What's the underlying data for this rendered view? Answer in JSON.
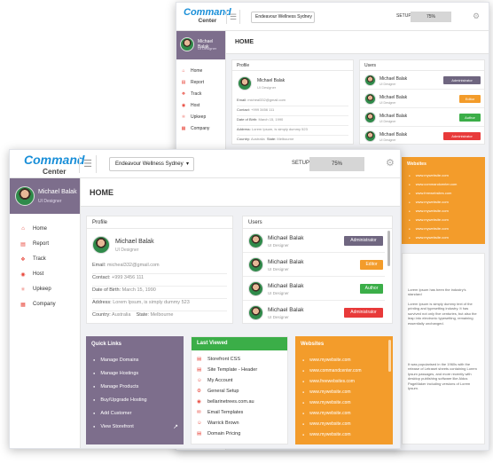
{
  "app": {
    "logo_main": "Command",
    "logo_sub": "Center",
    "company": "Endeavour Wellness Sydney",
    "setup_label": "SETUP",
    "setup_percent": "75%"
  },
  "user": {
    "name": "Michael Balak",
    "role": "UI Designer"
  },
  "sidebar": {
    "items": [
      {
        "label": "Home",
        "icon": "home-icon"
      },
      {
        "label": "Report",
        "icon": "report-icon"
      },
      {
        "label": "Track",
        "icon": "track-icon"
      },
      {
        "label": "Host",
        "icon": "host-icon"
      },
      {
        "label": "Upkeep",
        "icon": "upkeep-icon"
      },
      {
        "label": "Company",
        "icon": "company-icon"
      }
    ]
  },
  "page": {
    "title": "HOME"
  },
  "profile": {
    "header": "Profile",
    "name": "Michael Balak",
    "role": "UI Designer",
    "email_label": "Email:",
    "email": "micheal332@gmail.com",
    "contact_label": "Contact:",
    "contact": "+999 3456 111",
    "dob_label": "Date of Birth:",
    "dob": "March 15, 1990",
    "address_label": "Address:",
    "address": "Lorem Ipsum, is simply dummy 523",
    "country_label": "Country:",
    "country": "Australia",
    "state_label": "State:",
    "state": "Melbourne"
  },
  "users": {
    "header": "Users",
    "rows": [
      {
        "name": "Michael Balak",
        "role": "UI Designer",
        "badge": "Administrator",
        "color": "#6f6680"
      },
      {
        "name": "Michael Balak",
        "role": "UI Designer",
        "badge": "Editor",
        "color": "#f39c2b"
      },
      {
        "name": "Michael Balak",
        "role": "UI Designer",
        "badge": "Author",
        "color": "#3bae48"
      },
      {
        "name": "Michael Balak",
        "role": "UI Designer",
        "badge": "Administrator",
        "color": "#e83a3a"
      }
    ]
  },
  "quick_links": {
    "header": "Quick Links",
    "items": [
      "Manage Domains",
      "Manage Hostings",
      "Manage Products",
      "Buy/Upgrade Hosting",
      "Add Customer",
      "View Storefront"
    ]
  },
  "last_viewed": {
    "header": "Last Viewed",
    "items": [
      "Storefront CSS",
      "Site Template - Header",
      "My Account",
      "General Setup",
      "bellarinetrees.com.au",
      "Email Templates",
      "Warrick Brown",
      "Domain Pricing"
    ]
  },
  "websites": {
    "header": "Websites",
    "items": [
      "www.mywebsite.com",
      "www.commandcenter.com",
      "www.freewebsites.com",
      "www.mywebsite.com",
      "www.mywebsite.com",
      "www.mywebsite.com",
      "www.mywebsite.com",
      "www.mywebsite.com"
    ]
  },
  "back_text": {
    "p1": "Lorem Ipsum has been the industry's standard",
    "p2": "Lorem Ipsum is simply dummy text of the printing and typesetting industry. It has survived not only five centuries, but also the leap into electronic typesetting, remaining essentially unchanged.",
    "p3": "It was popularised in the 1960s with the release of Letraset sheets containing Lorem Ipsum passages, and more recently with desktop publishing software like Aldus PageMaker including versions of Lorem Ipsum."
  },
  "colors": {
    "sidebar_user": "#7d6e8c",
    "quick_links": "#7d6e8c",
    "last_viewed": "#3bae48",
    "websites": "#f39c2b",
    "accent": "#e8463a"
  }
}
